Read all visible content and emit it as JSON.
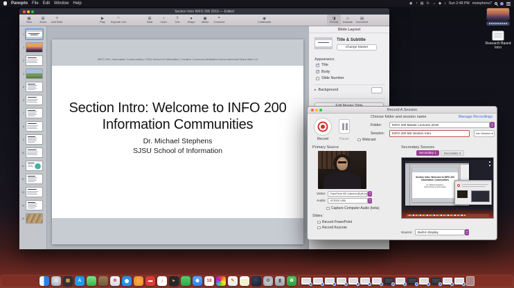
{
  "colors": {
    "accent_purple": "#8e3f97",
    "record_red": "#d22f27",
    "link_blue": "#3a6fd6",
    "session_field_border": "#c0504d",
    "active_tab": "#9b3d98"
  },
  "menu_bar": {
    "app_name": "Panopto",
    "menus": [
      "File",
      "Edit",
      "Window",
      "Help"
    ],
    "status_icons": [
      {
        "name": "user-switch-icon",
        "glyph": "◉"
      },
      {
        "name": "time-machine-icon",
        "glyph": "◔"
      },
      {
        "name": "display-icon",
        "glyph": "▤"
      },
      {
        "name": "sync-icon",
        "glyph": "↻"
      },
      {
        "name": "upload-icon",
        "glyph": "→"
      },
      {
        "name": "airplay-icon",
        "glyph": "◆"
      },
      {
        "name": "volume-icon",
        "glyph": "♪"
      }
    ],
    "clock": "Sun 2:48 PM",
    "account": "mstephens7"
  },
  "desktop": {
    "doc_file_label": "Research Based Intro"
  },
  "keynote": {
    "window_title": "Section Intro INFO 200 2019 — Edited",
    "toolbar": {
      "left": [
        {
          "name": "view-button",
          "label": "View",
          "glyph": "▦"
        },
        {
          "name": "zoom-button",
          "label": "Zoom",
          "glyph": "⊞"
        },
        {
          "name": "add-slide-button",
          "label": "Add Slide",
          "glyph": "＋"
        }
      ],
      "play": [
        {
          "name": "play-button",
          "label": "Play",
          "glyph": "▶"
        },
        {
          "name": "keynote-live-button",
          "label": "Keynote Live",
          "glyph": "◠"
        }
      ],
      "insert": [
        {
          "name": "table-button",
          "label": "Table",
          "glyph": "⊞"
        },
        {
          "name": "chart-button",
          "label": "Chart",
          "glyph": "◔"
        },
        {
          "name": "text-button",
          "label": "Text",
          "glyph": "T"
        },
        {
          "name": "shape-button",
          "label": "Shape",
          "glyph": "●"
        },
        {
          "name": "media-button",
          "label": "Media",
          "glyph": "▣"
        },
        {
          "name": "comment-button",
          "label": "Comment",
          "glyph": "❝"
        }
      ],
      "share": [
        {
          "name": "collaborate-button",
          "label": "Collaborate",
          "glyph": "◉"
        }
      ],
      "panels": [
        {
          "name": "format-tab",
          "label": "Format",
          "glyph": "◨",
          "state": "sel"
        },
        {
          "name": "animate-tab",
          "label": "Animate",
          "glyph": "◇",
          "state": ""
        },
        {
          "name": "document-tab",
          "label": "Document",
          "glyph": "▤",
          "state": ""
        }
      ]
    },
    "sidebar_thumbnails": [
      {
        "n": "1",
        "kind": "k-title",
        "sel": "sel"
      },
      {
        "n": "2",
        "kind": "k-sunset",
        "sel": ""
      },
      {
        "n": "3",
        "kind": "k-text",
        "sel": ""
      },
      {
        "n": "4",
        "kind": "k-field",
        "sel": ""
      },
      {
        "n": "5",
        "kind": "k-bullets",
        "sel": ""
      },
      {
        "n": "6",
        "kind": "k-text",
        "sel": ""
      },
      {
        "n": "7",
        "kind": "k-bullets",
        "sel": ""
      },
      {
        "n": "8",
        "kind": "k-text",
        "sel": ""
      },
      {
        "n": "9",
        "kind": "k-bullets",
        "sel": ""
      },
      {
        "n": "10",
        "kind": "k-text",
        "sel": ""
      },
      {
        "n": "11",
        "kind": "k-diagram",
        "sel": ""
      },
      {
        "n": "12",
        "kind": "k-bullets",
        "sel": ""
      },
      {
        "n": "13",
        "kind": "k-text",
        "sel": ""
      },
      {
        "n": "14",
        "kind": "k-bullets",
        "sel": ""
      },
      {
        "n": "15",
        "kind": "k-rope",
        "sel": ""
      }
    ],
    "slide": {
      "meta_line": "INFO 200 | Information Communities | SJSU School of Information | Creative Commons Attribution-Noncommercial-Share Alike 4.0",
      "title_line1": "Section Intro: Welcome to INFO 200",
      "title_line2": "Information Communities",
      "subtitle_line1": "Dr. Michael Stephens",
      "subtitle_line2": "SJSU School of Information"
    },
    "inspector": {
      "panel_title": "Slide Layout",
      "master_name": "Title & Subtitle",
      "change_master_button": "Change Master",
      "appearance_label": "Appearance",
      "appearance_options": [
        {
          "name": "appearance-title-checkbox",
          "label": "Title",
          "state": "checked"
        },
        {
          "name": "appearance-body-checkbox",
          "label": "Body",
          "state": "checked"
        },
        {
          "name": "appearance-slide-number-checkbox",
          "label": "Slide Number",
          "state": ""
        }
      ],
      "background_label": "Background",
      "edit_master_button": "Edit Master Slide"
    }
  },
  "record_dialog": {
    "title": "Record A Session",
    "record_button": "Record",
    "pause_button": "Pause",
    "header": "Choose folder and session name",
    "manage_link": "Manage Recordings",
    "folder_label": "Folder:",
    "folder_value": "INFO 200 Master Lectures 2019",
    "session_label": "Session:",
    "session_value": "INFO 200 MS Section Intro",
    "join_button": "Join Session ▾",
    "webcast_label": "Webcast",
    "primary_header": "Primary Source",
    "video_label": "Video:",
    "video_value": "FaceTime HD Camera (Built-in)",
    "audio_label": "Audio:",
    "audio_value": "AT2020 USB",
    "capture_audio_label": "Capture Computer Audio (beta)",
    "slides_label": "Slides:",
    "record_powerpoint_label": "Record PowerPoint",
    "record_keynote_label": "Record Keynote",
    "secondary_header": "Secondary Sources",
    "tabs": [
      {
        "name": "secondary-1-tab",
        "label": "Secondary 1",
        "state": "active"
      },
      {
        "name": "secondary-2-tab",
        "label": "Secondary 2",
        "state": ""
      }
    ],
    "source_label": "Source:",
    "source_value": "Built-in Display"
  },
  "dock": {
    "apps": [
      {
        "name": "finder-icon",
        "bg": "linear-gradient(90deg,#f2f6fb 0 46%,#2e7de9 46%)"
      },
      {
        "name": "launchpad-icon",
        "bg": "radial-gradient(circle at 50% 40%,#e8eaee,#9aa0a8)"
      },
      {
        "name": "utilities-icon",
        "bg": "#2f3038",
        "glyph": "▦",
        "gc": "#e0a43c"
      },
      {
        "name": "app-store-icon",
        "bg": "#1d9bf0",
        "glyph": "A",
        "gc": "#ffffff"
      },
      {
        "name": "messages-icon",
        "bg": "linear-gradient(180deg,#7ce58a,#2fb64e)"
      },
      {
        "name": "folder-icon",
        "bg": "linear-gradient(180deg,#9a7a58,#71573c)"
      },
      {
        "name": "photos-icon",
        "bg": "linear-gradient(180deg,#f4f6fa,#d6dce8)",
        "glyph": "✽",
        "gc": "#e0718a"
      },
      {
        "name": "safari-icon",
        "bg": "radial-gradient(circle at 50% 50%,#f0f7ff 0 29%,#2f8fe8 31%)"
      },
      {
        "name": "orange-app-icon",
        "bg": "radial-gradient(circle,#f8b04a,#e8862a)"
      },
      {
        "name": "do-not-disturb-icon",
        "bg": "#e03a34",
        "glyph": "▬",
        "gc": "#ffffff"
      },
      {
        "name": "itunes-icon",
        "bg": "#ffffff",
        "glyph": "♪",
        "gc": "#e0383e"
      },
      {
        "name": "media-app-icon",
        "bg": "#26262e",
        "glyph": "▸",
        "gc": "#e8b83c"
      },
      {
        "name": "green-app-icon",
        "bg": "linear-gradient(180deg,#58d06a,#2aa648)"
      },
      {
        "name": "video-call-icon",
        "bg": "linear-gradient(180deg,#5aa8ff,#2d7de8)",
        "glyph": "◉",
        "gc": "#ffffff"
      },
      {
        "name": "calendar-icon",
        "bg": "#f8f8fa",
        "glyph": "18",
        "gc": "#e0383e"
      },
      {
        "name": "browser-icon",
        "bg": "conic-gradient(#e8433c,#f5a623,#f8e71c,#7ed321,#4a90d9,#bd10e0,#e8433c)"
      },
      {
        "name": "pages-icon",
        "bg": "linear-gradient(180deg,#fbfbfd,#e8e8ee)",
        "glyph": "✎",
        "gc": "#e8902a"
      },
      {
        "name": "notes-icon",
        "bg": "linear-gradient(180deg,#ffffff 0 30%,#f4f1cf 30%)"
      },
      {
        "name": "dark-app-icon",
        "bg": "radial-gradient(circle at 40% 35%,#31445e,#131c2c)"
      },
      {
        "name": "system-preferences-icon",
        "bg": "radial-gradient(circle,#d3d6da,#9aa0a8)",
        "glyph": "⚙",
        "gc": "#55575c"
      },
      {
        "name": "microphone-icon",
        "bg": "linear-gradient(180deg,#caccd2,#9aa0a8)",
        "glyph": "▮",
        "gc": "#4a4c52"
      },
      {
        "name": "recycle-icon",
        "bg": "linear-gradient(180deg,#4ec45e,#2e9e3e)",
        "glyph": "♻",
        "gc": "#ffffff"
      }
    ],
    "minimized": [
      "light",
      "light",
      "light",
      "light",
      "light",
      "light",
      "light",
      "dark",
      "light",
      "dark",
      "light",
      "dark",
      "light",
      "light"
    ]
  }
}
